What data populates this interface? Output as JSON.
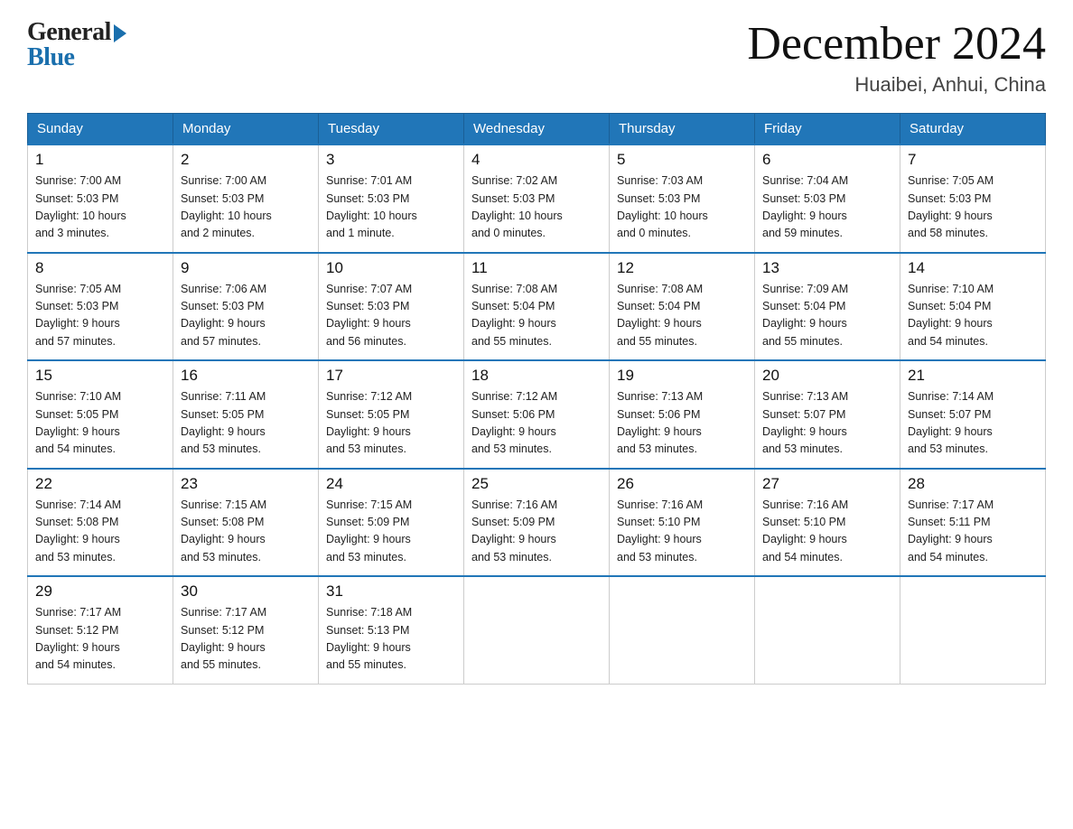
{
  "header": {
    "logo_general": "General",
    "logo_blue": "Blue",
    "title": "December 2024",
    "location": "Huaibei, Anhui, China"
  },
  "days_of_week": [
    "Sunday",
    "Monday",
    "Tuesday",
    "Wednesday",
    "Thursday",
    "Friday",
    "Saturday"
  ],
  "weeks": [
    [
      {
        "day": "1",
        "info": "Sunrise: 7:00 AM\nSunset: 5:03 PM\nDaylight: 10 hours\nand 3 minutes."
      },
      {
        "day": "2",
        "info": "Sunrise: 7:00 AM\nSunset: 5:03 PM\nDaylight: 10 hours\nand 2 minutes."
      },
      {
        "day": "3",
        "info": "Sunrise: 7:01 AM\nSunset: 5:03 PM\nDaylight: 10 hours\nand 1 minute."
      },
      {
        "day": "4",
        "info": "Sunrise: 7:02 AM\nSunset: 5:03 PM\nDaylight: 10 hours\nand 0 minutes."
      },
      {
        "day": "5",
        "info": "Sunrise: 7:03 AM\nSunset: 5:03 PM\nDaylight: 10 hours\nand 0 minutes."
      },
      {
        "day": "6",
        "info": "Sunrise: 7:04 AM\nSunset: 5:03 PM\nDaylight: 9 hours\nand 59 minutes."
      },
      {
        "day": "7",
        "info": "Sunrise: 7:05 AM\nSunset: 5:03 PM\nDaylight: 9 hours\nand 58 minutes."
      }
    ],
    [
      {
        "day": "8",
        "info": "Sunrise: 7:05 AM\nSunset: 5:03 PM\nDaylight: 9 hours\nand 57 minutes."
      },
      {
        "day": "9",
        "info": "Sunrise: 7:06 AM\nSunset: 5:03 PM\nDaylight: 9 hours\nand 57 minutes."
      },
      {
        "day": "10",
        "info": "Sunrise: 7:07 AM\nSunset: 5:03 PM\nDaylight: 9 hours\nand 56 minutes."
      },
      {
        "day": "11",
        "info": "Sunrise: 7:08 AM\nSunset: 5:04 PM\nDaylight: 9 hours\nand 55 minutes."
      },
      {
        "day": "12",
        "info": "Sunrise: 7:08 AM\nSunset: 5:04 PM\nDaylight: 9 hours\nand 55 minutes."
      },
      {
        "day": "13",
        "info": "Sunrise: 7:09 AM\nSunset: 5:04 PM\nDaylight: 9 hours\nand 55 minutes."
      },
      {
        "day": "14",
        "info": "Sunrise: 7:10 AM\nSunset: 5:04 PM\nDaylight: 9 hours\nand 54 minutes."
      }
    ],
    [
      {
        "day": "15",
        "info": "Sunrise: 7:10 AM\nSunset: 5:05 PM\nDaylight: 9 hours\nand 54 minutes."
      },
      {
        "day": "16",
        "info": "Sunrise: 7:11 AM\nSunset: 5:05 PM\nDaylight: 9 hours\nand 53 minutes."
      },
      {
        "day": "17",
        "info": "Sunrise: 7:12 AM\nSunset: 5:05 PM\nDaylight: 9 hours\nand 53 minutes."
      },
      {
        "day": "18",
        "info": "Sunrise: 7:12 AM\nSunset: 5:06 PM\nDaylight: 9 hours\nand 53 minutes."
      },
      {
        "day": "19",
        "info": "Sunrise: 7:13 AM\nSunset: 5:06 PM\nDaylight: 9 hours\nand 53 minutes."
      },
      {
        "day": "20",
        "info": "Sunrise: 7:13 AM\nSunset: 5:07 PM\nDaylight: 9 hours\nand 53 minutes."
      },
      {
        "day": "21",
        "info": "Sunrise: 7:14 AM\nSunset: 5:07 PM\nDaylight: 9 hours\nand 53 minutes."
      }
    ],
    [
      {
        "day": "22",
        "info": "Sunrise: 7:14 AM\nSunset: 5:08 PM\nDaylight: 9 hours\nand 53 minutes."
      },
      {
        "day": "23",
        "info": "Sunrise: 7:15 AM\nSunset: 5:08 PM\nDaylight: 9 hours\nand 53 minutes."
      },
      {
        "day": "24",
        "info": "Sunrise: 7:15 AM\nSunset: 5:09 PM\nDaylight: 9 hours\nand 53 minutes."
      },
      {
        "day": "25",
        "info": "Sunrise: 7:16 AM\nSunset: 5:09 PM\nDaylight: 9 hours\nand 53 minutes."
      },
      {
        "day": "26",
        "info": "Sunrise: 7:16 AM\nSunset: 5:10 PM\nDaylight: 9 hours\nand 53 minutes."
      },
      {
        "day": "27",
        "info": "Sunrise: 7:16 AM\nSunset: 5:10 PM\nDaylight: 9 hours\nand 54 minutes."
      },
      {
        "day": "28",
        "info": "Sunrise: 7:17 AM\nSunset: 5:11 PM\nDaylight: 9 hours\nand 54 minutes."
      }
    ],
    [
      {
        "day": "29",
        "info": "Sunrise: 7:17 AM\nSunset: 5:12 PM\nDaylight: 9 hours\nand 54 minutes."
      },
      {
        "day": "30",
        "info": "Sunrise: 7:17 AM\nSunset: 5:12 PM\nDaylight: 9 hours\nand 55 minutes."
      },
      {
        "day": "31",
        "info": "Sunrise: 7:18 AM\nSunset: 5:13 PM\nDaylight: 9 hours\nand 55 minutes."
      },
      null,
      null,
      null,
      null
    ]
  ]
}
